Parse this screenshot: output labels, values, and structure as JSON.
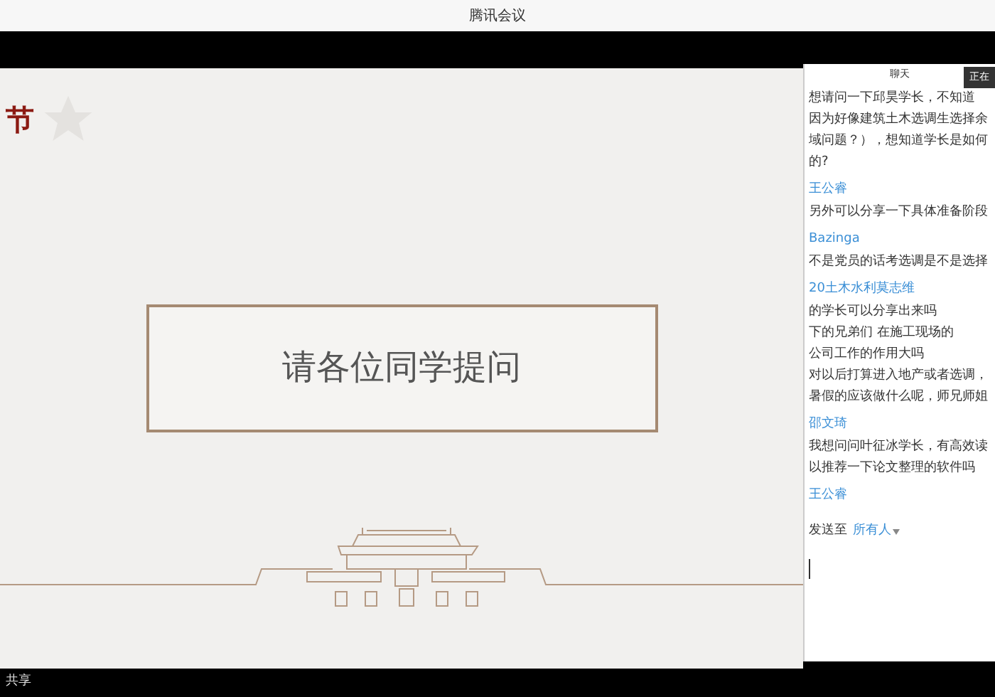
{
  "window": {
    "title": "腾讯会议"
  },
  "slide": {
    "corner_title": "节",
    "prompt": "请各位同学提问"
  },
  "chat": {
    "title": "聊天",
    "tooltip": "正在",
    "messages": [
      {
        "kind": "text",
        "text": "想请问一下邱昊学长，不知道"
      },
      {
        "kind": "text",
        "text": "因为好像建筑土木选调生选择余"
      },
      {
        "kind": "text",
        "text": "域问题？），想知道学长是如何"
      },
      {
        "kind": "text",
        "text": "的?"
      },
      {
        "kind": "name",
        "text": "王公睿"
      },
      {
        "kind": "text",
        "text": "另外可以分享一下具体准备阶段"
      },
      {
        "kind": "name",
        "text": "Bazinga"
      },
      {
        "kind": "text",
        "text": "不是党员的话考选调是不是选择"
      },
      {
        "kind": "name",
        "text": "20土木水利莫志维"
      },
      {
        "kind": "text",
        "text": "的学长可以分享出来吗"
      },
      {
        "kind": "text",
        "text": "下的兄弟们 在施工现场的"
      },
      {
        "kind": "text",
        "text": "公司工作的作用大吗"
      },
      {
        "kind": "text",
        "text": "对以后打算进入地产或者选调，"
      },
      {
        "kind": "text",
        "text": "暑假的应该做什么呢，师兄师姐"
      },
      {
        "kind": "name",
        "text": "邵文琦"
      },
      {
        "kind": "text",
        "text": "我想问问叶征冰学长，有高效读"
      },
      {
        "kind": "text",
        "text": "以推荐一下论文整理的软件吗"
      },
      {
        "kind": "name",
        "text": "王公睿"
      }
    ],
    "send_to_label": "发送至",
    "send_to_value": "所有人"
  },
  "status_bar": {
    "share_label": "共享"
  }
}
